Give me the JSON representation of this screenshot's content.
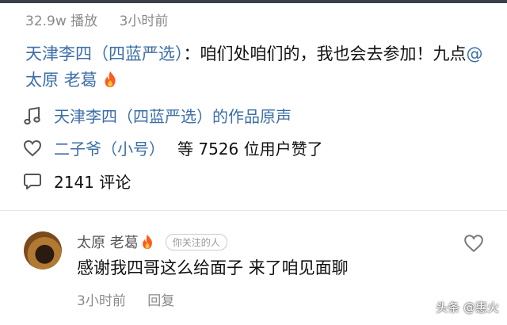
{
  "header": {
    "plays": "32.9w 播放",
    "time": "3小时前"
  },
  "caption": {
    "author": "天津李四（四蓝严选）",
    "text": "：咱们处咱们的，我也会去参加！九点",
    "mention": "@太原 老葛"
  },
  "sound": {
    "label": "天津李四（四蓝严选）的作品原声",
    "icon": "music-note-icon"
  },
  "likes": {
    "user": "二子爷（小号）",
    "text": "等 7526 位用户赞了",
    "icon": "heart-outline-icon"
  },
  "comments": {
    "text": "2141 评论",
    "icon": "comment-bubble-icon"
  },
  "comment": {
    "author": "太原 老葛",
    "badge": "你关注的人",
    "text": "感谢我四哥这么给面子 来了咱见面聊",
    "time": "3小时前",
    "reply": "回复"
  },
  "watermark": "头条 @惠火",
  "colors": {
    "link": "#3b6ea8",
    "muted": "#8a8a8a",
    "flame": "#ff5a1f"
  }
}
